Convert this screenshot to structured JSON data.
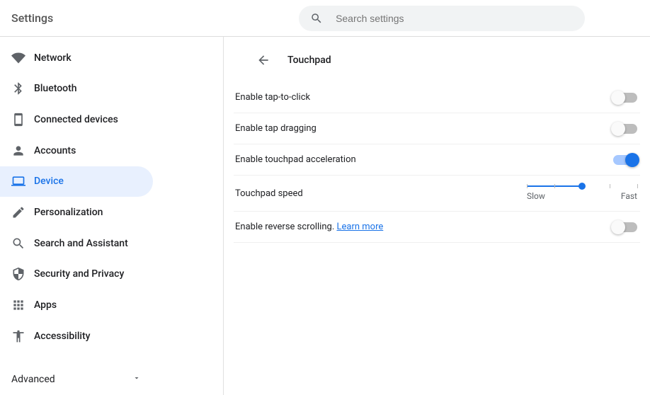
{
  "header": {
    "title": "Settings",
    "search_placeholder": "Search settings"
  },
  "sidebar": {
    "items": [
      {
        "label": "Network",
        "icon": "wifi"
      },
      {
        "label": "Bluetooth",
        "icon": "bluetooth"
      },
      {
        "label": "Connected devices",
        "icon": "devices"
      },
      {
        "label": "Accounts",
        "icon": "person"
      },
      {
        "label": "Device",
        "icon": "laptop"
      },
      {
        "label": "Personalization",
        "icon": "edit"
      },
      {
        "label": "Search and Assistant",
        "icon": "search"
      },
      {
        "label": "Security and Privacy",
        "icon": "shield"
      },
      {
        "label": "Apps",
        "icon": "apps"
      },
      {
        "label": "Accessibility",
        "icon": "accessibility"
      }
    ],
    "advanced_label": "Advanced"
  },
  "main": {
    "page_title": "Touchpad",
    "settings": {
      "tap_to_click": {
        "label": "Enable tap-to-click",
        "value": false
      },
      "tap_dragging": {
        "label": "Enable tap dragging",
        "value": false
      },
      "acceleration": {
        "label": "Enable touchpad acceleration",
        "value": true
      },
      "speed": {
        "label": "Touchpad speed",
        "slow_label": "Slow",
        "fast_label": "Fast",
        "value": 3,
        "min": 1,
        "max": 5
      },
      "reverse_scroll": {
        "label": "Enable reverse scrolling.",
        "learn_more": "Learn more",
        "value": false
      }
    }
  }
}
